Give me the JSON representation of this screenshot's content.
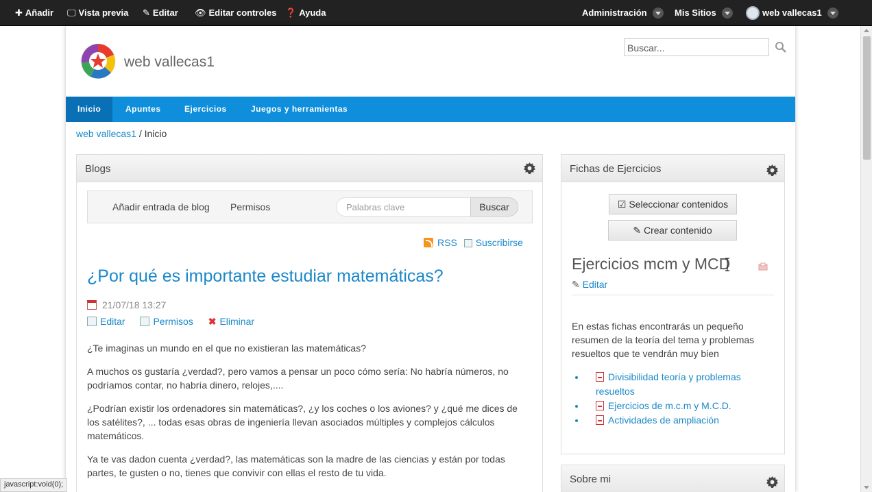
{
  "dockbar": {
    "add": "Añadir",
    "preview": "Vista previa",
    "edit": "Editar",
    "edit_controls": "Editar controles",
    "help": "Ayuda",
    "admin": "Administración",
    "my_sites": "Mis Sitios",
    "user": "web vallecas1"
  },
  "header": {
    "site_name": "web vallecas1",
    "search_value": "Buscar..."
  },
  "nav": {
    "items": [
      "Inicio",
      "Apuntes",
      "Ejercicios",
      "Juegos y herramientas"
    ]
  },
  "breadcrumb": {
    "site": "web vallecas1",
    "current": "Inicio"
  },
  "blogs": {
    "title": "Blogs",
    "add_entry": "Añadir entrada de blog",
    "permissions": "Permisos",
    "keywords_placeholder": "Palabras clave",
    "search_btn": "Buscar",
    "rss": "RSS",
    "subscribe": "Suscribirse",
    "post": {
      "title": "¿Por qué es importante estudiar matemáticas?",
      "date": "21/07/18 13:27",
      "edit": "Editar",
      "permissions": "Permisos",
      "delete": "Eliminar",
      "paragraphs": [
        "¿Te imaginas un mundo en el que no existieran las matemáticas?",
        "A muchos os gustaría ¿verdad?, pero vamos a pensar un poco cómo sería: No habría números, no podríamos contar, no habría dinero, relojes,....",
        "¿Podrían existir los ordenadores sin matemáticas?, ¿y los coches o los aviones? y ¿qué me dices de los satélites?, ... todas esas obras de ingeniería llevan asociados múltiples y complejos cálculos matemáticos.",
        "Ya te vas dadon cuenta ¿verdad?, las matemáticas son la madre de las ciencias y están por todas partes, te gusten o no, tienes que convivir con ellas el resto de tu vida."
      ]
    }
  },
  "fichas": {
    "title": "Fichas de Ejercicios",
    "select_btn": "Seleccionar contenidos",
    "create_btn": "Crear contenido",
    "content_title": "Ejercicios mcm y MCD",
    "edit": "Editar",
    "description": "En estas fichas encontrarás un pequeño resumen de la teoría del tema y problemas resueltos que te vendrán muy bien",
    "files": [
      "Divisibilidad teoría y problemas resueltos",
      "Ejercicios de m.c.m y M.C.D.",
      "Actividades de ampliación"
    ]
  },
  "sobre": {
    "title": "Sobre mi"
  },
  "status_url": "javascript:void(0);"
}
